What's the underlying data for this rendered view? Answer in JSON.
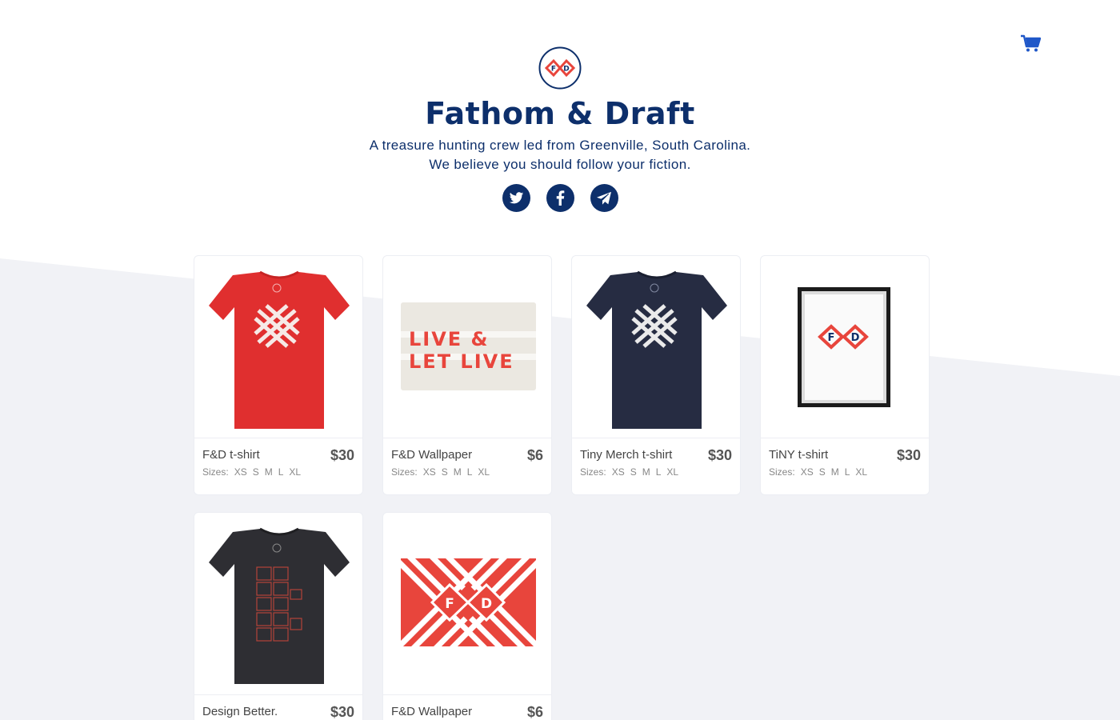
{
  "brand": {
    "title": "Fathom & Draft",
    "tagline_1": "A treasure hunting crew led from Greenville, South Carolina.",
    "tagline_2": "We believe you should follow your fiction.",
    "logo_letters": [
      "F",
      "D"
    ]
  },
  "colors": {
    "navy": "#0d2f6b",
    "red": "#e8453c",
    "bg_gray": "#f1f2f6"
  },
  "icons": {
    "cart": "shopping-cart-icon",
    "social": [
      "twitter-icon",
      "facebook-icon",
      "telegram-icon"
    ]
  },
  "sizes_label": "Sizes:",
  "products": [
    {
      "name": "F&D t-shirt",
      "price": "$30",
      "sizes": [
        "XS",
        "S",
        "M",
        "L",
        "XL"
      ],
      "image": "red-tshirt"
    },
    {
      "name": "F&D Wallpaper",
      "price": "$6",
      "sizes": [
        "XS",
        "S",
        "M",
        "L",
        "XL"
      ],
      "image": "live-and-let-live-wallpaper",
      "image_text_1": "LIVE  &",
      "image_text_2": "LET LIVE"
    },
    {
      "name": "Tiny Merch t-shirt",
      "price": "$30",
      "sizes": [
        "XS",
        "S",
        "M",
        "L",
        "XL"
      ],
      "image": "navy-tshirt"
    },
    {
      "name": "TiNY t-shirt",
      "price": "$30",
      "sizes": [
        "XS",
        "S",
        "M",
        "L",
        "XL"
      ],
      "image": "framed-print"
    },
    {
      "name": "Design Better.",
      "price": "$30",
      "sizes": [],
      "image": "black-tshirt"
    },
    {
      "name": "F&D Wallpaper",
      "price": "$6",
      "sizes": [],
      "image": "fd-pattern-wallpaper"
    }
  ]
}
